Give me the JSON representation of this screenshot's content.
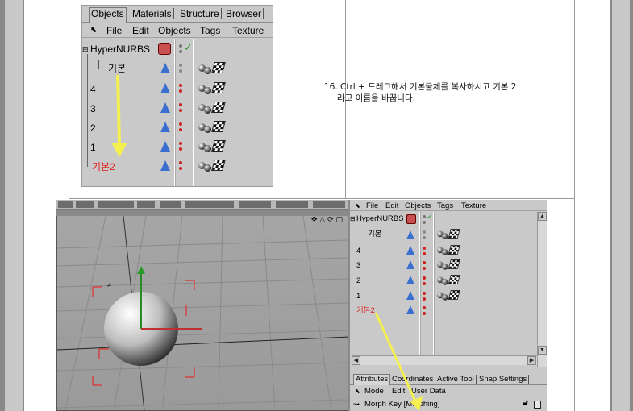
{
  "top_object_manager": {
    "tabs": [
      "Objects",
      "Materials",
      "Structure",
      "Browser"
    ],
    "menu": [
      "File",
      "Edit",
      "Objects",
      "Tags",
      "Texture"
    ],
    "rows": [
      {
        "name": "HyperNURBS",
        "color": "#000000"
      },
      {
        "name": "기본",
        "color": "#000000"
      },
      {
        "name": "4",
        "color": "#000000"
      },
      {
        "name": "3",
        "color": "#000000"
      },
      {
        "name": "2",
        "color": "#000000"
      },
      {
        "name": "1",
        "color": "#000000"
      },
      {
        "name": "기본2",
        "color": "#e02020"
      }
    ]
  },
  "instruction": {
    "line1": "16. Ctrl + 드레그해서 기본물체를 복사하시고 기본 2",
    "line2": "라고 이름을 바꿉니다."
  },
  "viewport": {
    "nav_icons": "✥ △ ⟳ ▢"
  },
  "bottom_object_manager": {
    "menu": [
      "File",
      "Edit",
      "Objects",
      "Tags",
      "Texture"
    ],
    "rows": [
      {
        "name": "HyperNURBS",
        "color": "#000000"
      },
      {
        "name": "기본",
        "color": "#000000"
      },
      {
        "name": "4",
        "color": "#000000"
      },
      {
        "name": "3",
        "color": "#000000"
      },
      {
        "name": "2",
        "color": "#000000"
      },
      {
        "name": "1",
        "color": "#000000"
      },
      {
        "name": "기본2",
        "color": "#e02020"
      }
    ],
    "attr_tabs": [
      "Attributes",
      "Coordinates",
      "Active Tool",
      "Snap Settings"
    ],
    "attr_menu": [
      "Mode",
      "Edit",
      "User Data"
    ],
    "attr_row_label": "Morph Key [Morphing]"
  },
  "colors": {
    "selected_red": "#e02020",
    "cone_blue": "#3a6fd0",
    "arrow_yellow": "#f5f050"
  }
}
